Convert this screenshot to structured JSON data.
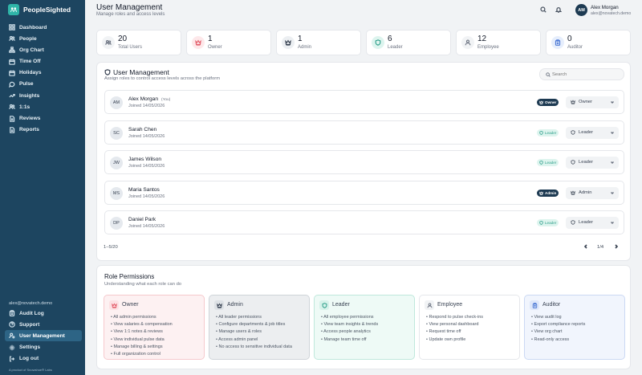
{
  "brand": {
    "name": "PeopleSighted"
  },
  "sidebar": {
    "items": [
      {
        "label": "Dashboard",
        "icon": "grid-icon"
      },
      {
        "label": "People",
        "icon": "people-icon"
      },
      {
        "label": "Org Chart",
        "icon": "org-chart-icon"
      },
      {
        "label": "Time Off",
        "icon": "calendar-icon"
      },
      {
        "label": "Holidays",
        "icon": "calendar-icon"
      },
      {
        "label": "Pulse",
        "icon": "chat-icon"
      },
      {
        "label": "Insights",
        "icon": "trend-icon"
      },
      {
        "label": "1:1s",
        "icon": "people-icon"
      },
      {
        "label": "Reviews",
        "icon": "document-icon"
      },
      {
        "label": "Reports",
        "icon": "document-icon"
      }
    ],
    "email": "alex@novatech.demo",
    "bottom_items": [
      {
        "label": "Audit Log",
        "icon": "clipboard-icon"
      },
      {
        "label": "Support",
        "icon": "help-icon"
      },
      {
        "label": "User Management",
        "icon": "user-gear-icon"
      },
      {
        "label": "Settings",
        "icon": "gear-icon"
      },
      {
        "label": "Log out",
        "icon": "logout-icon"
      }
    ],
    "copyright": "A product of Snowshoe® Labs"
  },
  "header": {
    "title": "User Management",
    "subtitle": "Manage roles and access levels",
    "user_initials": "AM",
    "user_name": "Alex Morgan",
    "user_email": "alex@novatech.demo"
  },
  "stats": [
    {
      "value": "20",
      "label": "Total Users",
      "icon": "users-icon",
      "color": "#6b7280",
      "bg": "#f1f3f5"
    },
    {
      "value": "1",
      "label": "Owner",
      "icon": "crown-icon",
      "color": "#e35d6a",
      "bg": "#fde8ea"
    },
    {
      "value": "1",
      "label": "Admin",
      "icon": "crown-icon",
      "color": "#374151",
      "bg": "#eceff2"
    },
    {
      "value": "6",
      "label": "Leader",
      "icon": "shield-icon",
      "color": "#2e9f8a",
      "bg": "#ddf4ee"
    },
    {
      "value": "12",
      "label": "Employee",
      "icon": "user-icon",
      "color": "#6b7280",
      "bg": "#f1f3f5"
    },
    {
      "value": "0",
      "label": "Auditor",
      "icon": "clipboard-icon",
      "color": "#4f7bd6",
      "bg": "#e6eefc"
    }
  ],
  "panel": {
    "title": "User Management",
    "subtitle": "Assign roles to control access levels across the platform",
    "search_placeholder": "Search",
    "users": [
      {
        "initials": "AM",
        "name": "Alex Morgan",
        "you": "(You)",
        "joined": "Joined 14/05/2026",
        "badge": "Owner",
        "badge_style": "dark",
        "role": "Owner",
        "role_icon": "crown-icon"
      },
      {
        "initials": "SC",
        "name": "Sarah Chen",
        "you": "",
        "joined": "Joined 14/05/2026",
        "badge": "Leader",
        "badge_style": "leader",
        "role": "Leader",
        "role_icon": "shield-icon"
      },
      {
        "initials": "JW",
        "name": "James Wilson",
        "you": "",
        "joined": "Joined 14/05/2026",
        "badge": "Leader",
        "badge_style": "leader",
        "role": "Leader",
        "role_icon": "shield-icon"
      },
      {
        "initials": "MS",
        "name": "Maria Santos",
        "you": "",
        "joined": "Joined 14/05/2026",
        "badge": "Admin",
        "badge_style": "dark",
        "role": "Admin",
        "role_icon": "crown-icon"
      },
      {
        "initials": "DP",
        "name": "Daniel Park",
        "you": "",
        "joined": "Joined 14/05/2026",
        "badge": "Leader",
        "badge_style": "leader",
        "role": "Leader",
        "role_icon": "shield-icon"
      }
    ],
    "pager_range": "1–5/20",
    "pager_page": "1/4"
  },
  "permissions": {
    "title": "Role Permissions",
    "subtitle": "Understanding what each role can do",
    "roles": [
      {
        "name": "Owner",
        "icon": "crown-icon",
        "color": "#e35d6a",
        "bg": "#fdf1f2",
        "border": "#f6c9cd",
        "icon_bg": "#fde1e4",
        "items": [
          "All admin permissions",
          "View salaries & compensation",
          "View 1:1 notes & reviews",
          "View individual pulse data",
          "Manage billing & settings",
          "Full organization control"
        ]
      },
      {
        "name": "Admin",
        "icon": "crown-icon",
        "color": "#374151",
        "bg": "#eceef0",
        "border": "#cfd4d9",
        "icon_bg": "#dde1e5",
        "items": [
          "All leader permissions",
          "Configure departments & job titles",
          "Manage users & roles",
          "Access admin panel",
          "No access to sensitive individual data"
        ]
      },
      {
        "name": "Leader",
        "icon": "shield-icon",
        "color": "#2e9f8a",
        "bg": "#eefaf6",
        "border": "#bfe8dc",
        "icon_bg": "#d6f2ea",
        "items": [
          "All employee permissions",
          "View team insights & trends",
          "Access people analytics",
          "Manage team time off"
        ]
      },
      {
        "name": "Employee",
        "icon": "user-icon",
        "color": "#6b7280",
        "bg": "#ffffff",
        "border": "#e5e7eb",
        "icon_bg": "#f1f3f5",
        "items": [
          "Respond to pulse check-ins",
          "View personal dashboard",
          "Request time off",
          "Update own profile"
        ]
      },
      {
        "name": "Auditor",
        "icon": "clipboard-icon",
        "color": "#4f7bd6",
        "bg": "#f1f5fd",
        "border": "#cbd9f4",
        "icon_bg": "#dde7fa",
        "items": [
          "View audit log",
          "Export compliance reports",
          "View org chart",
          "Read-only access"
        ]
      }
    ]
  }
}
